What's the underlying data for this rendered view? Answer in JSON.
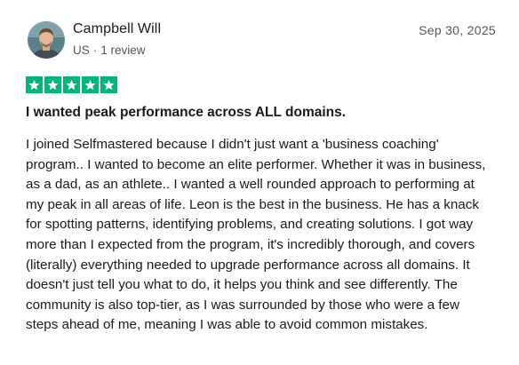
{
  "reviewer": {
    "name": "Campbell Will",
    "country": "US",
    "separator": "·",
    "review_count": "1 review",
    "avatar_icon": "user-photo-avatar"
  },
  "review": {
    "date": "Sep 30, 2025",
    "rating": 5,
    "max_rating": 5,
    "star_color": "#00b67a",
    "title": "I wanted peak performance across ALL domains.",
    "body": "I joined Selfmastered because I didn't just want a 'business coaching' program.. I wanted to become an elite performer. Whether it was in business, as a dad, as an athlete.. I wanted a well rounded approach to performing at my peak in all areas of life. Leon is the best in the business. He has a knack for spotting patterns, identifying problems, and creating solutions. I got way more than I expected from the program, it's incredibly thorough, and covers (literally) everything needed to upgrade performance across all domains. It doesn't just tell you what to do, it helps you think and see differently. The community is also top-tier, as I was surrounded by those who were a few steps ahead of me, meaning I was able to avoid common mistakes."
  }
}
